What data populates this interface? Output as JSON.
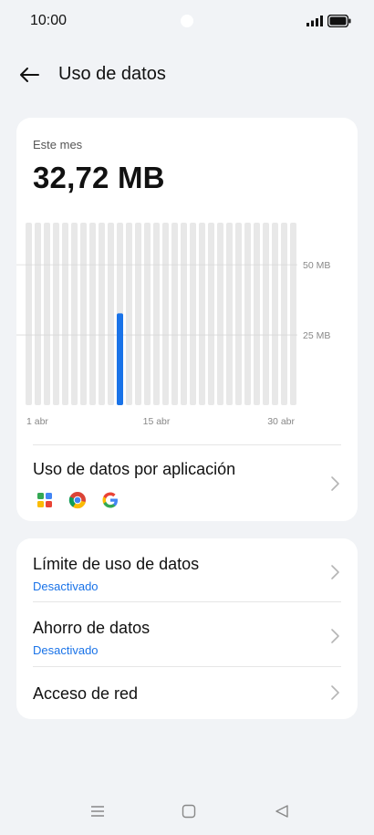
{
  "status_bar": {
    "time": "10:00"
  },
  "header": {
    "title": "Uso de datos"
  },
  "usage": {
    "period_label": "Este mes",
    "total": "32,72 MB"
  },
  "chart_data": {
    "type": "bar",
    "days": 30,
    "values_mb": [
      0,
      0,
      0,
      0,
      0,
      0,
      0,
      0,
      0,
      0,
      32.72,
      0,
      0,
      0,
      0,
      0,
      0,
      0,
      0,
      0,
      0,
      0,
      0,
      0,
      0,
      0,
      0,
      0,
      0,
      0
    ],
    "highlight_color": "#1a73e8",
    "track_color": "#e8e8e8",
    "y_ticks": [
      {
        "value": 50,
        "label": "50 MB"
      },
      {
        "value": 25,
        "label": "25 MB"
      }
    ],
    "ylim": [
      0,
      65
    ],
    "x_labels": [
      {
        "day": 1,
        "label": "1 abr"
      },
      {
        "day": 15,
        "label": "15 abr"
      },
      {
        "day": 30,
        "label": "30 abr"
      }
    ]
  },
  "app_usage": {
    "label": "Uso de datos por aplicación",
    "apps": [
      "apps-icon",
      "chrome-icon",
      "google-icon"
    ]
  },
  "settings": {
    "limit": {
      "label": "Límite de uso de datos",
      "status": "Desactivado"
    },
    "saver": {
      "label": "Ahorro de datos",
      "status": "Desactivado"
    },
    "network": {
      "label": "Acceso de red"
    }
  }
}
